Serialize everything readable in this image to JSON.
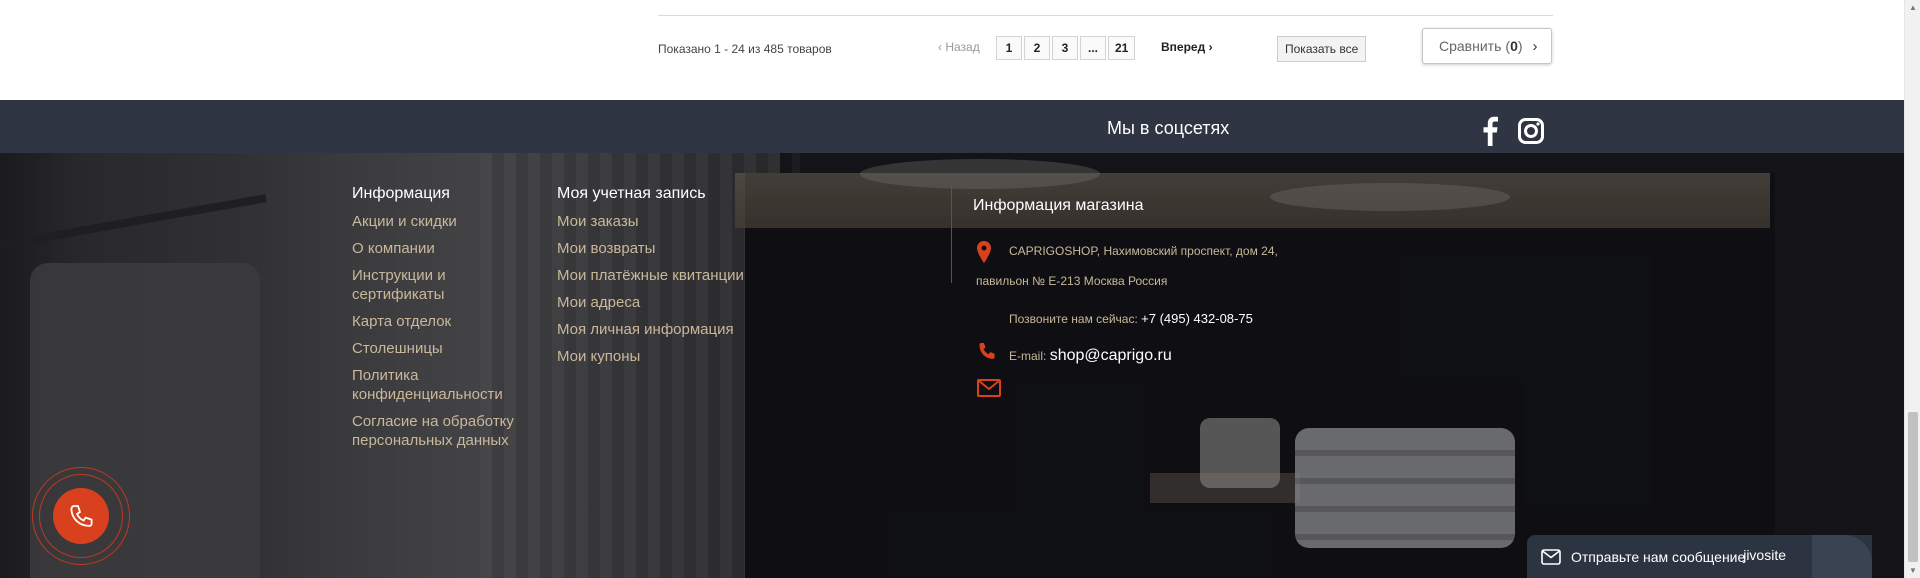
{
  "pagination": {
    "results_text": "Показано 1 - 24 из 485 товаров",
    "prev_label": "Назад",
    "pages": [
      "1",
      "2",
      "3",
      "...",
      "21"
    ],
    "next_label": "Вперед",
    "show_all_label": "Показать все",
    "compare_label": "Сравнить",
    "compare_count": "0"
  },
  "social": {
    "title": "Мы в соцсетях",
    "icons": [
      "facebook-icon",
      "instagram-icon"
    ]
  },
  "footer": {
    "info": {
      "title": "Информация",
      "links": [
        "Акции и скидки",
        "О компании",
        "Инструкции и сертификаты",
        "Карта отделок",
        "Столешницы",
        "Политика конфиденциальности",
        "Согласие на обработку персональных данных"
      ]
    },
    "account": {
      "title": "Моя учетная запись",
      "links": [
        "Мои заказы",
        "Мои возвраты",
        "Мои платёжные квитанции",
        "Мои адреса",
        "Моя личная информация",
        "Мои купоны"
      ]
    },
    "store": {
      "title": "Информация магазина",
      "address_line1": "CAPRIGOSHOP, Нахимовский проспект, дом 24,",
      "address_line2": "павильон № Е-213 Москва Россия",
      "phone_label": "Позвоните нам сейчас:",
      "phone": "+7 (495) 432-08-75",
      "email_label": "E-mail:",
      "email": "shop@caprigo.ru"
    }
  },
  "chat": {
    "label": "Отправьте нам сообщение",
    "brand": "jivosite"
  },
  "colors": {
    "accent": "#d9411e",
    "link": "#c9b89a",
    "bar": "#2f3542"
  }
}
